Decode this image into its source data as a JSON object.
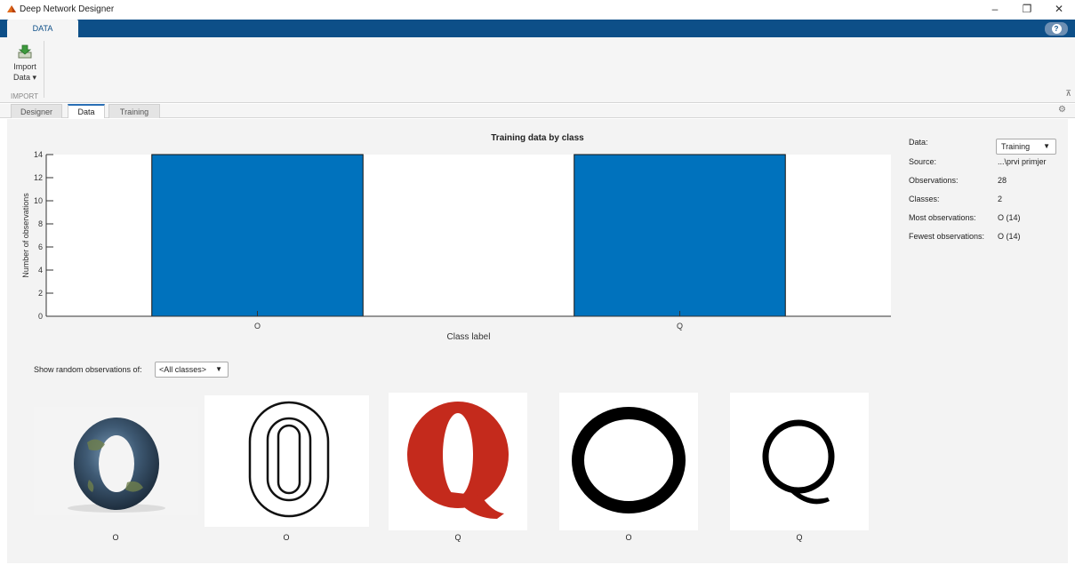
{
  "window": {
    "title": "Deep Network Designer",
    "minimize": "–",
    "restore": "❐",
    "close": "✕"
  },
  "ribbon": {
    "tab_label": "DATA",
    "help_icon": "?"
  },
  "toolstrip": {
    "import_line1": "Import",
    "import_line2": "Data ▾",
    "section_label": "IMPORT",
    "collapse_glyph": "⊼"
  },
  "doc_tabs": [
    {
      "label": "Designer",
      "active": false
    },
    {
      "label": "Data",
      "active": true
    },
    {
      "label": "Training",
      "active": false
    }
  ],
  "info": {
    "data_label": "Data:",
    "data_value": "Training",
    "source_label": "Source:",
    "source_value": "...\\prvi primjer",
    "observations_label": "Observations:",
    "observations_value": "28",
    "classes_label": "Classes:",
    "classes_value": "2",
    "most_label": "Most observations:",
    "most_value": "O (14)",
    "fewest_label": "Fewest observations:",
    "fewest_value": "O (14)"
  },
  "random": {
    "label": "Show random observations of:",
    "value": "<All classes>"
  },
  "thumbnails": [
    {
      "label": "O",
      "kind": "earth-o"
    },
    {
      "label": "O",
      "kind": "outline-zero"
    },
    {
      "label": "Q",
      "kind": "red-q"
    },
    {
      "label": "O",
      "kind": "ring-o"
    },
    {
      "label": "Q",
      "kind": "serif-q"
    }
  ],
  "chart_data": {
    "type": "bar",
    "title": "Training data by class",
    "xlabel": "Class label",
    "ylabel": "Number of observations",
    "categories": [
      "O",
      "Q"
    ],
    "values": [
      14,
      14
    ],
    "ylim": [
      0,
      14
    ],
    "yticks": [
      0,
      2,
      4,
      6,
      8,
      10,
      12,
      14
    ],
    "bar_color": "#0072bd",
    "grid": false
  }
}
